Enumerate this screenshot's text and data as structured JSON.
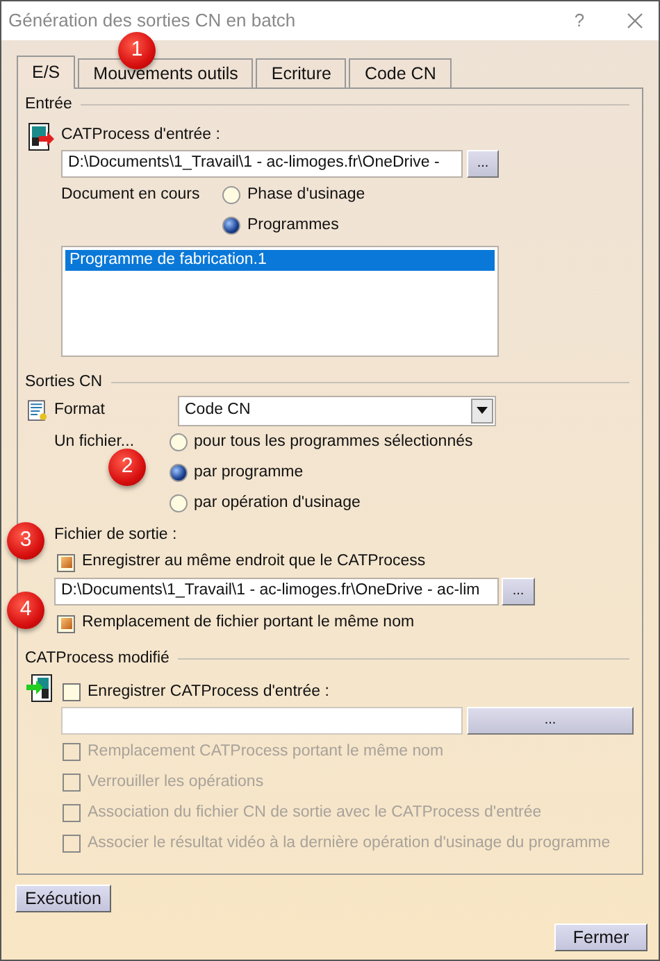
{
  "window": {
    "title": "Génération des sorties CN en batch",
    "help": "?"
  },
  "tabs": [
    {
      "label": "E/S",
      "selected": true
    },
    {
      "label": "Mouvements outils",
      "selected": false
    },
    {
      "label": "Ecriture",
      "selected": false
    },
    {
      "label": "Code CN",
      "selected": false
    }
  ],
  "entree": {
    "title": "Entrée",
    "input_label": "CATProcess d'entrée :",
    "input_path": "D:\\Documents\\1_Travail\\1 - ac-limoges.fr\\OneDrive -",
    "browse": "...",
    "document_label": "Document en cours",
    "document_options": [
      {
        "label": "Phase d'usinage",
        "selected": false
      },
      {
        "label": "Programmes",
        "selected": true
      }
    ],
    "list": [
      {
        "label": "Programme de fabrication.1",
        "selected": true
      }
    ]
  },
  "sorties_cn": {
    "title": "Sorties CN",
    "format_label": "Format",
    "format_value": "Code CN",
    "file_label": "Un fichier...",
    "file_options": [
      {
        "label": "pour tous les programmes sélectionnés",
        "selected": false
      },
      {
        "label": "par programme",
        "selected": true
      },
      {
        "label": "par opération d'usinage",
        "selected": false
      }
    ],
    "output_label": "Fichier de sortie :",
    "same_place": {
      "label": "Enregistrer au même endroit que le CATProcess",
      "checked": true
    },
    "output_path": "D:\\Documents\\1_Travail\\1 - ac-limoges.fr\\OneDrive - ac-lim",
    "browse": "...",
    "replace": {
      "label": "Remplacement de fichier portant le même nom",
      "checked": true
    }
  },
  "catprocess_modifie": {
    "title": "CATProcess modifié",
    "save": {
      "label": "Enregistrer CATProcess d'entrée :",
      "checked": false
    },
    "browse": "...",
    "options": [
      {
        "label": "Remplacement CATProcess portant le même nom",
        "checked": false,
        "disabled": true
      },
      {
        "label": "Verrouiller les opérations",
        "checked": false,
        "disabled": true
      },
      {
        "label": "Association du fichier CN de sortie avec le CATProcess d'entrée",
        "checked": false,
        "disabled": true
      },
      {
        "label": "Associer le résultat vidéo à la dernière opération d'usinage du programme",
        "checked": false,
        "disabled": true
      }
    ]
  },
  "buttons": {
    "run": "Exécution",
    "close": "Fermer"
  },
  "annotations": [
    "1",
    "2",
    "3",
    "4"
  ]
}
